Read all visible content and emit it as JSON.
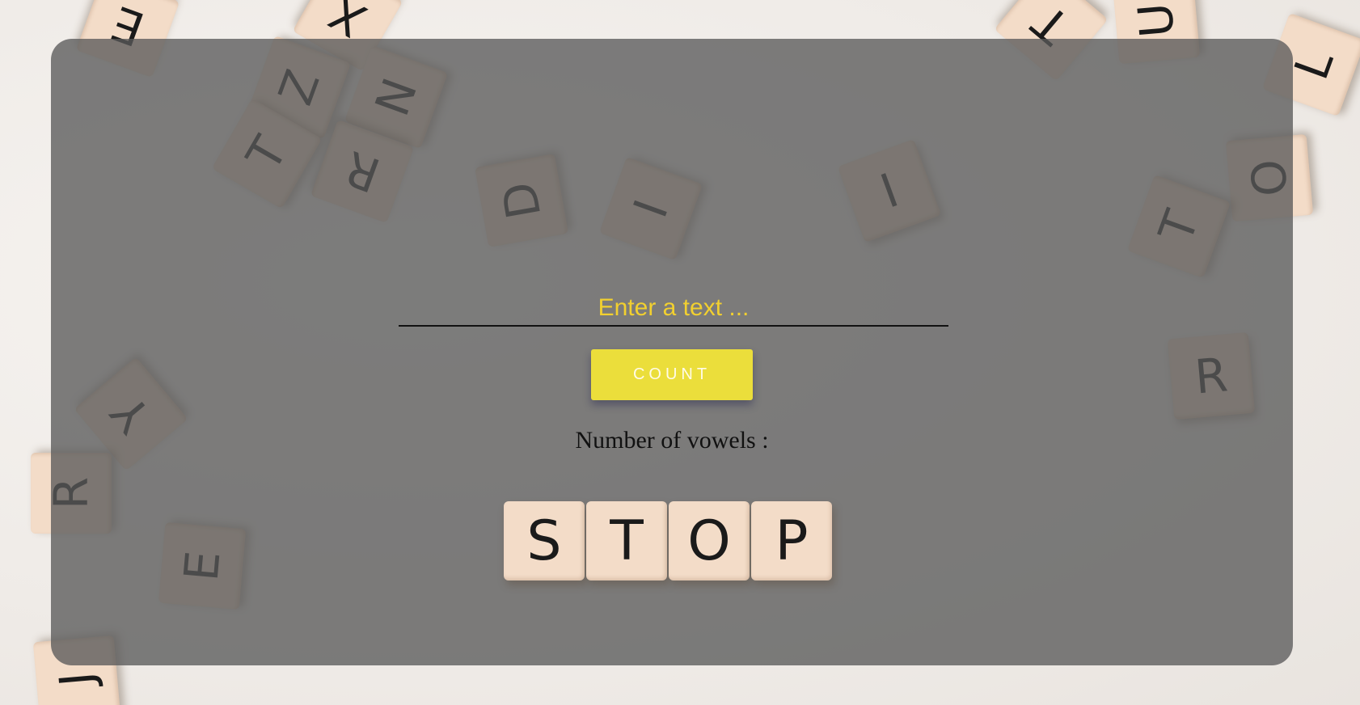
{
  "input": {
    "placeholder": "Enter a text ...",
    "value": ""
  },
  "count_button": {
    "label": "COUNT"
  },
  "result": {
    "label": "Number of vowels :"
  },
  "background_tiles": [
    {
      "letter": "E"
    },
    {
      "letter": "X"
    },
    {
      "letter": "Z"
    },
    {
      "letter": "N"
    },
    {
      "letter": "T"
    },
    {
      "letter": "R"
    },
    {
      "letter": "D"
    },
    {
      "letter": "I"
    },
    {
      "letter": "I"
    },
    {
      "letter": "T"
    },
    {
      "letter": "U"
    },
    {
      "letter": "L"
    },
    {
      "letter": "O"
    },
    {
      "letter": "T"
    },
    {
      "letter": "R"
    },
    {
      "letter": "Y"
    },
    {
      "letter": "R"
    },
    {
      "letter": "E"
    },
    {
      "letter": "J"
    }
  ],
  "stop_tiles": [
    "S",
    "T",
    "O",
    "P"
  ],
  "colors": {
    "accent": "#ebde3b",
    "placeholder": "#f2d02f",
    "overlay": "#5a5a5a"
  }
}
